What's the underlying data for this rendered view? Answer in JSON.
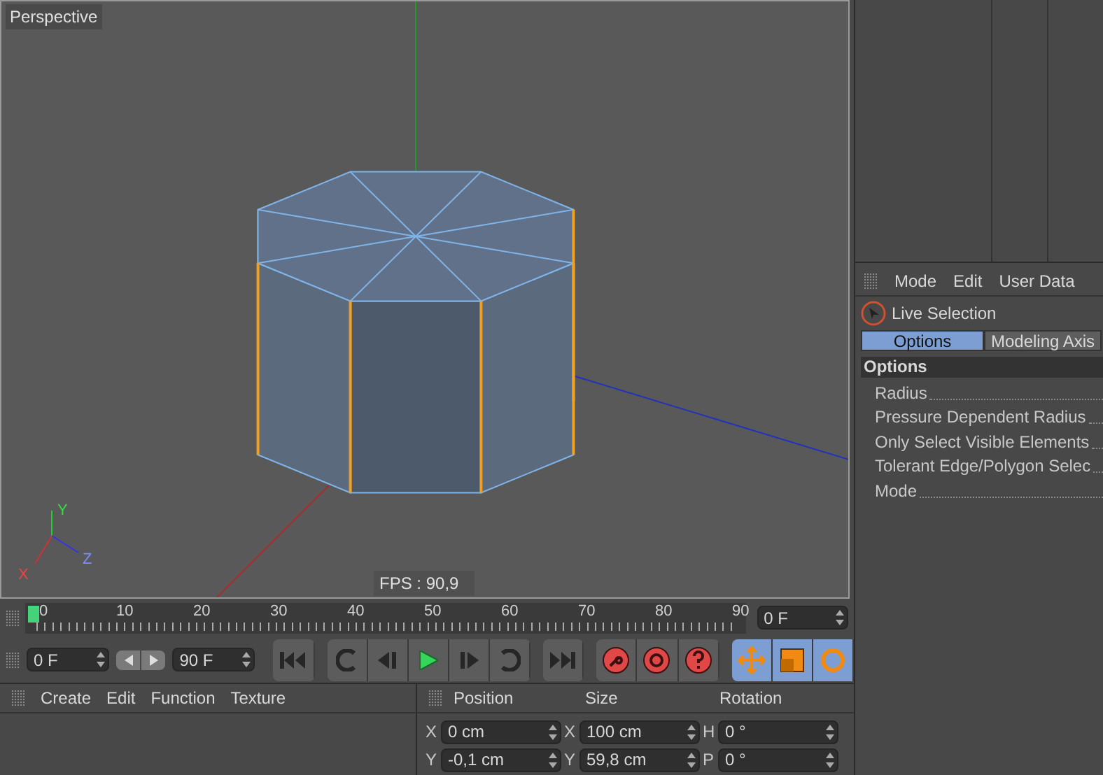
{
  "viewport": {
    "title": "Perspective",
    "fps": "FPS : 90,9",
    "axis_labels": [
      "X",
      "Y",
      "Z"
    ]
  },
  "timeline": {
    "ticks": [
      "0",
      "10",
      "20",
      "30",
      "40",
      "50",
      "60",
      "70",
      "80",
      "90"
    ],
    "level": 0,
    "current_frame": "0 F"
  },
  "transport": {
    "start_frame": "0 F",
    "end_frame": "90 F"
  },
  "materials": {
    "menu": [
      "Create",
      "Edit",
      "Function",
      "Texture"
    ]
  },
  "coordinates": {
    "headers": [
      "Position",
      "Size",
      "Rotation"
    ],
    "columns": [
      [
        {
          "axis": "X",
          "value": "0 cm"
        },
        {
          "axis": "Y",
          "value": "-0,1 cm"
        }
      ],
      [
        {
          "axis": "X",
          "value": "100 cm"
        },
        {
          "axis": "Y",
          "value": "59,8 cm"
        }
      ],
      [
        {
          "axis": "H",
          "value": "0 °"
        },
        {
          "axis": "P",
          "value": "0 °"
        }
      ]
    ]
  },
  "attributes": {
    "menu": [
      "Mode",
      "Edit",
      "User Data"
    ],
    "tool": "Live Selection",
    "tabs": [
      {
        "label": "Options",
        "selected": true
      },
      {
        "label": "Modeling Axis",
        "selected": false
      }
    ],
    "section": "Options",
    "params": [
      "Radius",
      "Pressure Dependent Radius",
      "Only Select Visible Elements",
      "Tolerant Edge/Polygon Selec",
      "Mode"
    ]
  }
}
